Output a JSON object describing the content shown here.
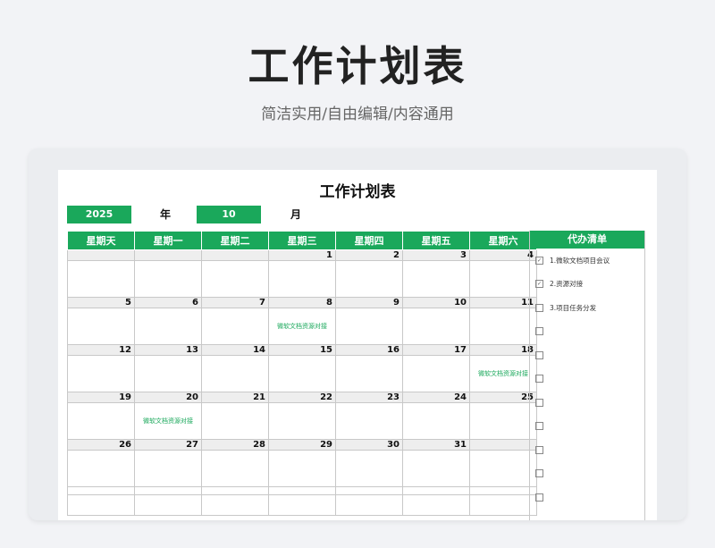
{
  "hero": {
    "title": "工作计划表",
    "subtitle": "简洁实用/自由编辑/内容通用"
  },
  "sheet": {
    "title": "工作计划表",
    "year": "2025",
    "year_label": "年",
    "month": "10",
    "month_label": "月",
    "weekdays": [
      "星期天",
      "星期一",
      "星期二",
      "星期三",
      "星期四",
      "星期五",
      "星期六"
    ],
    "weeks": [
      {
        "days": [
          "",
          "",
          "",
          "1",
          "2",
          "3",
          "4"
        ],
        "events": [
          "",
          "",
          "",
          "",
          "",
          "",
          ""
        ]
      },
      {
        "days": [
          "5",
          "6",
          "7",
          "8",
          "9",
          "10",
          "11"
        ],
        "events": [
          "",
          "",
          "",
          "微软文档资源对接",
          "",
          "",
          ""
        ]
      },
      {
        "days": [
          "12",
          "13",
          "14",
          "15",
          "16",
          "17",
          "18"
        ],
        "events": [
          "",
          "",
          "",
          "",
          "",
          "",
          "微软文档资源对接"
        ]
      },
      {
        "days": [
          "19",
          "20",
          "21",
          "22",
          "23",
          "24",
          "25"
        ],
        "events": [
          "",
          "微软文档资源对接",
          "",
          "",
          "",
          "",
          ""
        ]
      },
      {
        "days": [
          "26",
          "27",
          "28",
          "29",
          "30",
          "31",
          ""
        ],
        "events": [
          "",
          "",
          "",
          "",
          "",
          "",
          ""
        ]
      }
    ]
  },
  "todo": {
    "title": "代办清单",
    "items": [
      {
        "text": "1.微软文档项目会议",
        "checked": true
      },
      {
        "text": "2.资源对接",
        "checked": true
      },
      {
        "text": "3.项目任务分发",
        "checked": false
      },
      {
        "text": "",
        "checked": false
      },
      {
        "text": "",
        "checked": false
      },
      {
        "text": "",
        "checked": false
      },
      {
        "text": "",
        "checked": false
      },
      {
        "text": "",
        "checked": false
      },
      {
        "text": "",
        "checked": false
      },
      {
        "text": "",
        "checked": false
      },
      {
        "text": "",
        "checked": false
      }
    ],
    "check_mark": "✓"
  },
  "colors": {
    "accent": "#1aa85b",
    "background": "#f2f3f6"
  }
}
